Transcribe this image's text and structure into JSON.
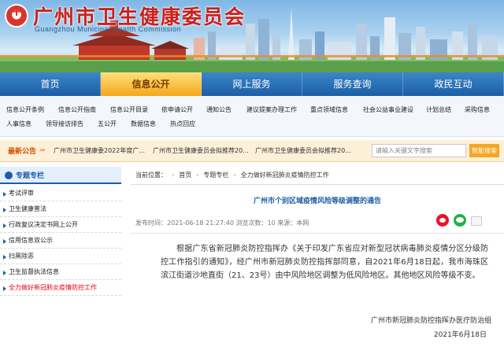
{
  "site": {
    "title": "广州市卫生健康委员会",
    "subtitle": "Guangzhou Municipal Health Commission"
  },
  "main_nav": [
    {
      "label": "首页",
      "active": false
    },
    {
      "label": "信息公开",
      "active": true
    },
    {
      "label": "网上服务",
      "active": false
    },
    {
      "label": "服务查询",
      "active": false
    },
    {
      "label": "政民互动",
      "active": false
    }
  ],
  "sub_nav": {
    "row1": [
      "信息公开条例",
      "信息公开指南",
      "信息公开目录",
      "依申请公开",
      "通知公告",
      "建议提案办理工作",
      "重点领域信息",
      "社会公益事业建设",
      "计划总结",
      "采购信息"
    ],
    "row2": [
      "人事信息",
      "领导接访排告",
      "五公开",
      "数据信息",
      "热点回应"
    ]
  },
  "ticker": {
    "label": "最新公告",
    "items": [
      "广州市卫生健康委2022年度广...",
      "广州市卫生健康委员会拟推荐20...",
      "广州市卫生健康委员会拟推荐20..."
    ],
    "search_placeholder": "请输入关键文字搜索",
    "search_button": "智能搜索"
  },
  "sidebar": {
    "title": "专题专栏",
    "items": [
      {
        "label": "考试评审",
        "active": false
      },
      {
        "label": "卫生健康普法",
        "active": false
      },
      {
        "label": "行政复议决定书网上公开",
        "active": false
      },
      {
        "label": "信用信息双公示",
        "active": false
      },
      {
        "label": "扫黑除恶",
        "active": false
      },
      {
        "label": "卫生监督执法信息",
        "active": false
      },
      {
        "label": "全力做好新冠肺炎疫情防控工作",
        "active": true
      }
    ]
  },
  "breadcrumb": {
    "prefix": "当前位置：",
    "items": [
      "首页",
      "专题专栏",
      "全力做好新冠肺炎疫情防控工作"
    ]
  },
  "article": {
    "title": "广州市个别区域疫情风险等级调整的通告",
    "meta": "发布时间：2021-06-18 21:27:40   浏览次数：10   来源：本网",
    "body": "根据广东省新冠肺炎防控指挥办《关于印发广东省应对新型冠状病毒肺炎疫情分区分级防控工作指引的通知》，经广州市新冠肺炎防控指挥部同意，自2021年6月18日起，我市海珠区滨江街道沙地直街（21、23号）由中风险地区调整为低风险地区。其他地区风险等级不变。",
    "signature": "广州市新冠肺炎防控指挥办医疗防治组",
    "date": "2021年6月18日"
  },
  "colors": {
    "nav_blue": "#1d5ea5",
    "active_orange": "#f4a71c",
    "title_red": "#cc1f1a",
    "link_blue": "#1d5ea5"
  }
}
